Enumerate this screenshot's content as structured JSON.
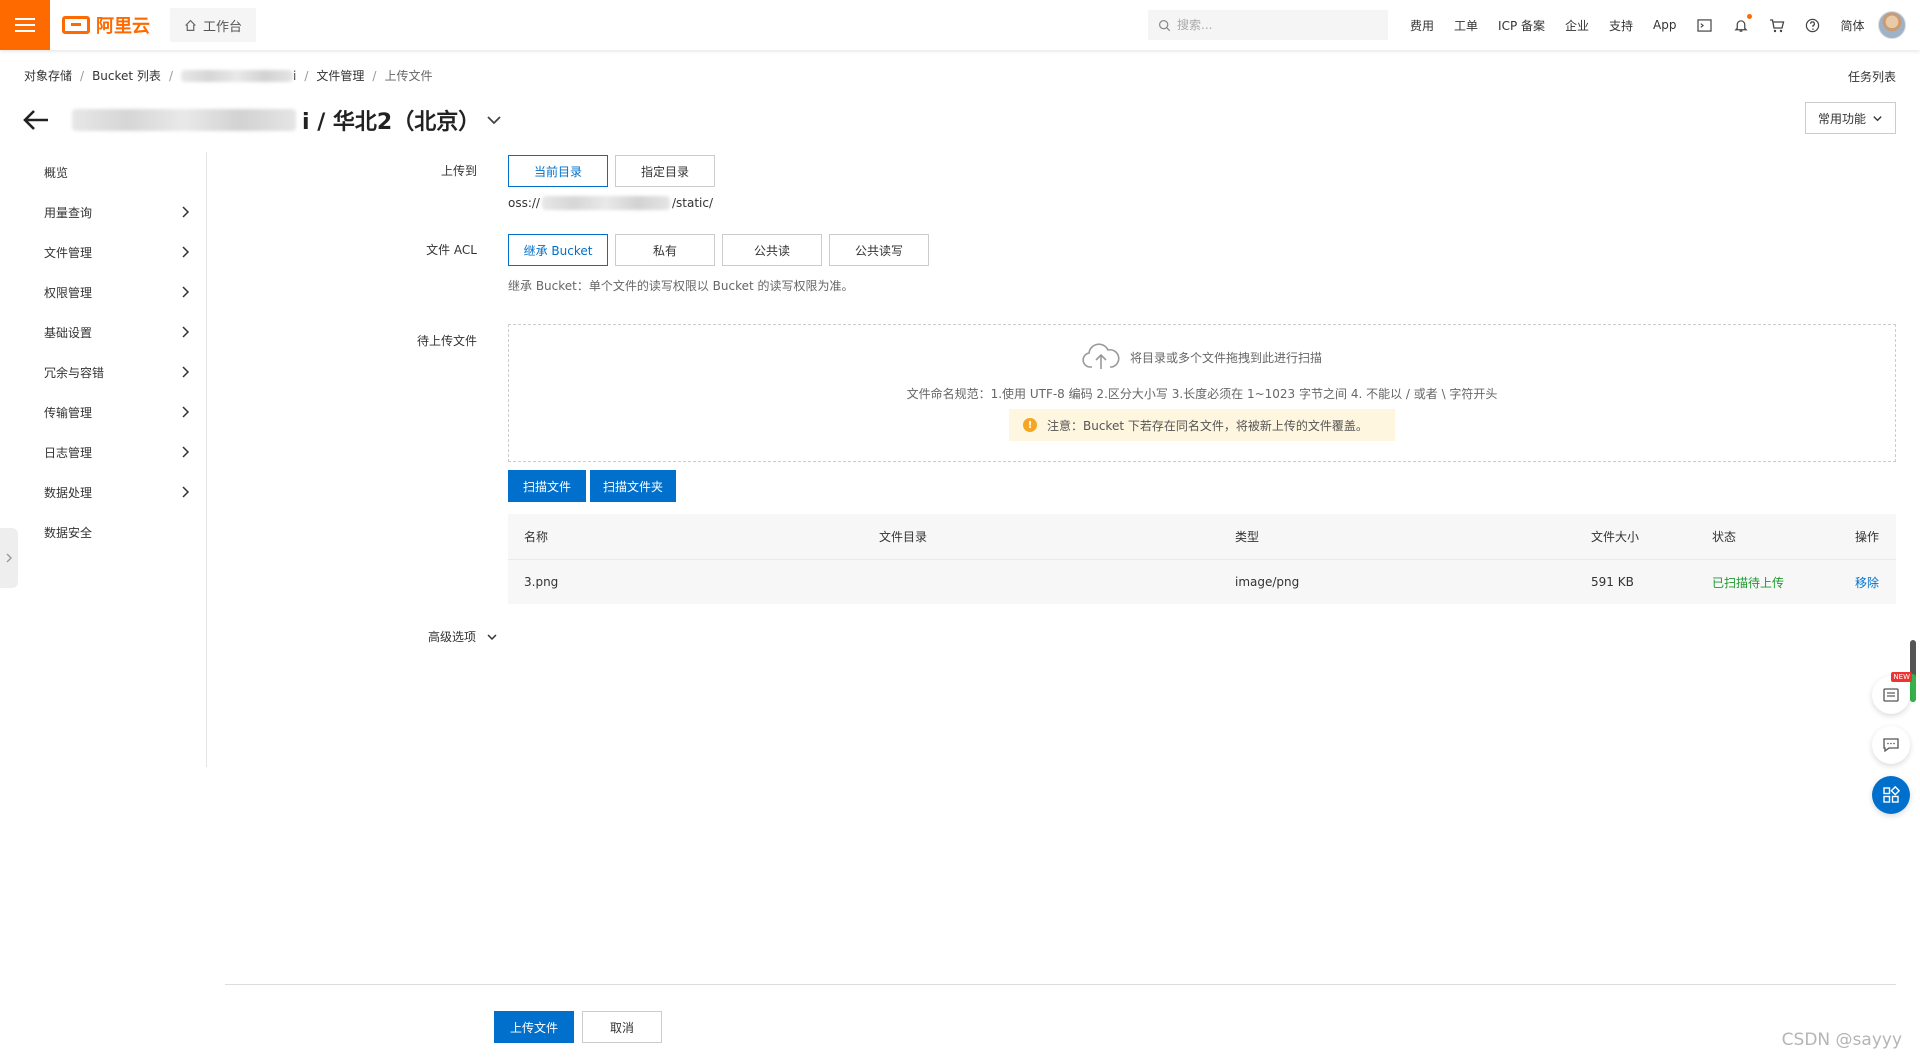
{
  "topbar": {
    "logo_text": "阿里云",
    "workbench_label": "工作台",
    "search_placeholder": "搜索...",
    "nav_items": [
      "费用",
      "工单",
      "ICP 备案",
      "企业",
      "支持",
      "App"
    ],
    "language": "简体"
  },
  "breadcrumb": {
    "items": [
      "对象存储",
      "Bucket 列表",
      "i",
      "文件管理",
      "上传文件"
    ]
  },
  "task_list": "任务列表",
  "header": {
    "title_suffix": "i / 华北2（北京）",
    "common_functions": "常用功能"
  },
  "sidebar": {
    "items": [
      {
        "label": "概览",
        "has_children": false
      },
      {
        "label": "用量查询",
        "has_children": true
      },
      {
        "label": "文件管理",
        "has_children": true
      },
      {
        "label": "权限管理",
        "has_children": true
      },
      {
        "label": "基础设置",
        "has_children": true
      },
      {
        "label": "冗余与容错",
        "has_children": true
      },
      {
        "label": "传输管理",
        "has_children": true
      },
      {
        "label": "日志管理",
        "has_children": true
      },
      {
        "label": "数据处理",
        "has_children": true
      },
      {
        "label": "数据安全",
        "has_children": false
      }
    ]
  },
  "form": {
    "upload_to": {
      "label": "上传到",
      "options": [
        "当前目录",
        "指定目录"
      ],
      "selected": "当前目录",
      "path_prefix": "oss://",
      "path_suffix": "/static/"
    },
    "acl": {
      "label": "文件 ACL",
      "options": [
        "继承 Bucket",
        "私有",
        "公共读",
        "公共读写"
      ],
      "selected": "继承 Bucket",
      "hint": "继承 Bucket：单个文件的读写权限以 Bucket 的读写权限为准。"
    },
    "pending": {
      "label": "待上传文件",
      "drop_text": "将目录或多个文件拖拽到此进行扫描",
      "rules": "文件命名规范：1.使用 UTF-8 编码 2.区分大小写 3.长度必须在 1~1023 字节之间 4. 不能以 / 或者 \\ 字符开头",
      "warning": "注意：Bucket 下若存在同名文件，将被新上传的文件覆盖。",
      "scan_file": "扫描文件",
      "scan_folder": "扫描文件夹"
    },
    "table": {
      "columns": [
        "名称",
        "文件目录",
        "类型",
        "文件大小",
        "状态",
        "操作"
      ],
      "rows": [
        {
          "name": "3.png",
          "dir": "",
          "type": "image/png",
          "size": "591 KB",
          "status": "已扫描待上传",
          "action": "移除"
        }
      ]
    },
    "advanced": "高级选项"
  },
  "footer": {
    "submit": "上传文件",
    "cancel": "取消"
  },
  "float": {
    "new_badge": "NEW"
  },
  "watermark": "CSDN @sayyy",
  "colors": {
    "brand": "#ff6a00",
    "primary": "#0070cc",
    "success": "#1b9a2e"
  }
}
